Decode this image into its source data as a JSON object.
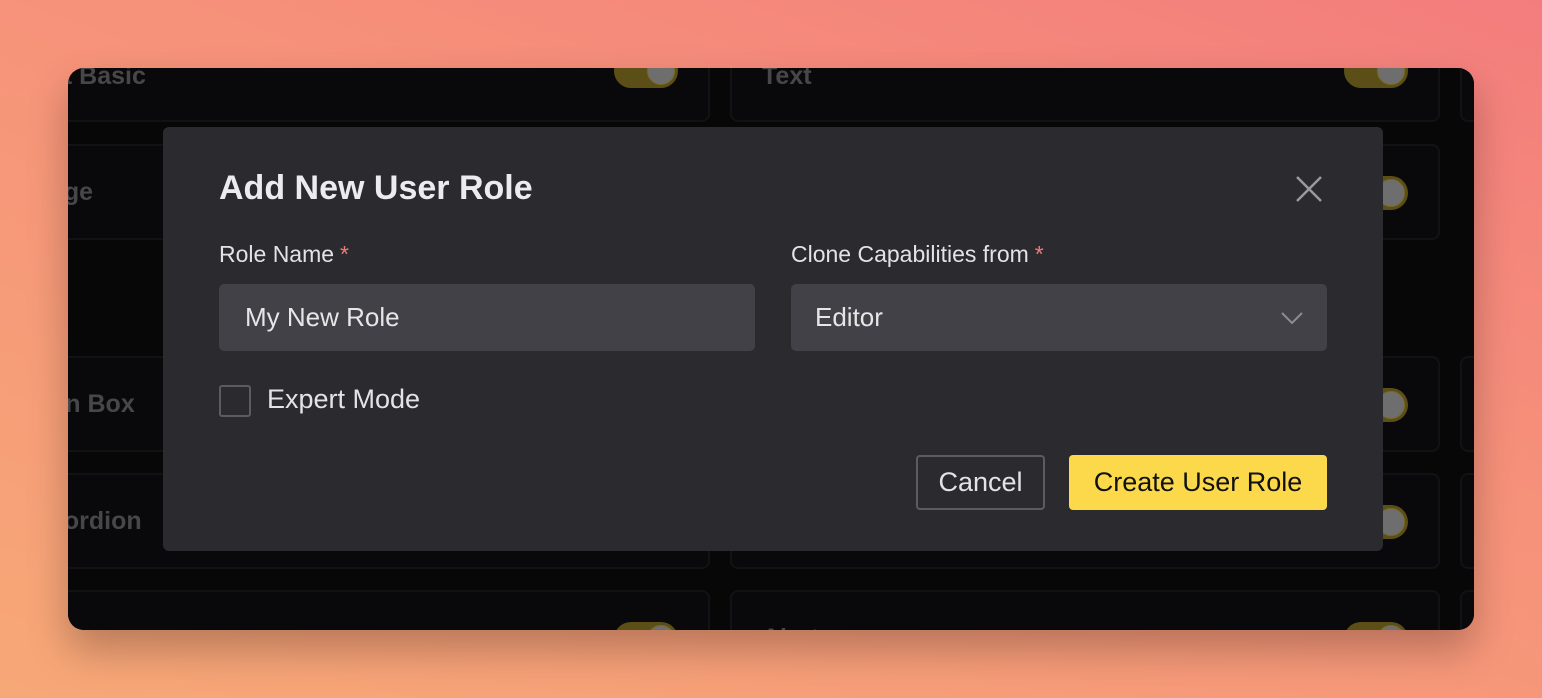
{
  "background_cards": [
    {
      "label": "xt Basic"
    },
    {
      "label": "Text"
    },
    {
      "label": "age"
    },
    {
      "label": "on Box"
    },
    {
      "label": "cordion"
    },
    {
      "label": "Alert"
    }
  ],
  "modal": {
    "title": "Add New User Role",
    "close_icon": "close-icon",
    "role_name": {
      "label": "Role Name",
      "required_marker": "*",
      "value": "My New Role"
    },
    "clone_from": {
      "label": "Clone Capabilities from",
      "required_marker": "*",
      "selected": "Editor",
      "icon": "chevron-down-icon"
    },
    "expert_mode": {
      "label": "Expert Mode",
      "checked": false
    },
    "buttons": {
      "cancel": "Cancel",
      "create": "Create User Role"
    }
  },
  "colors": {
    "accent": "#fcd94a",
    "required": "#ef7b78",
    "modal_bg": "#2b2a2f",
    "input_bg": "#424147"
  }
}
